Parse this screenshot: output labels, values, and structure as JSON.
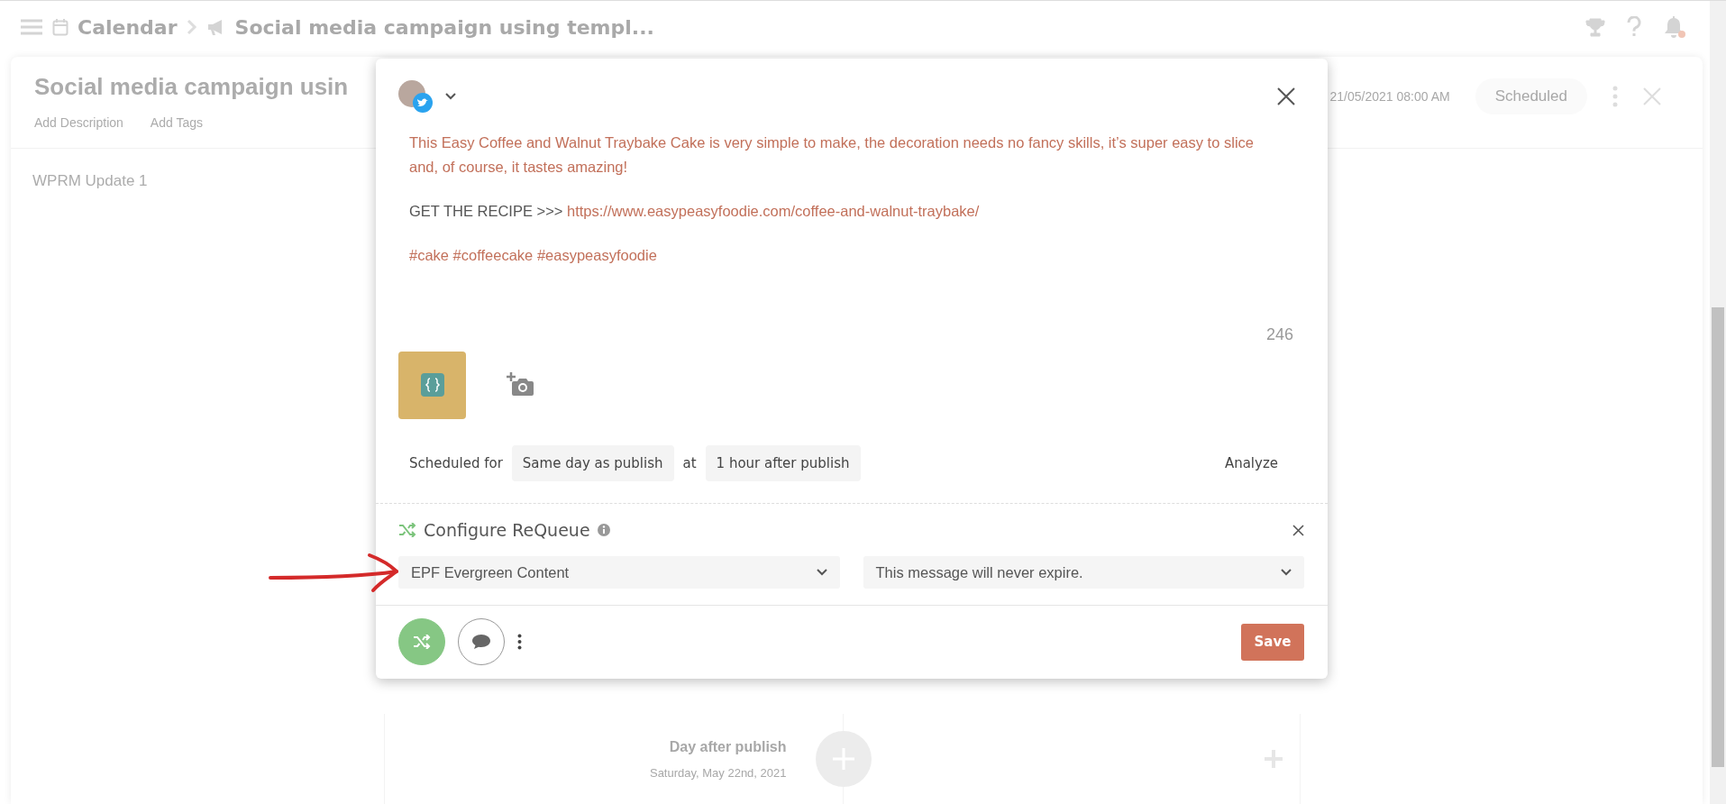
{
  "top_bar": {
    "breadcrumbs": [
      {
        "kind": "calendar",
        "label": "Calendar"
      },
      {
        "kind": "campaign",
        "label": "Social media campaign using templ..."
      }
    ],
    "has_notification": true
  },
  "campaign": {
    "title": "Social media campaign usin",
    "links": [
      "Add Description",
      "Add Tags"
    ],
    "date": "21/05/2021 08:00 AM",
    "status": "Scheduled",
    "items": [
      "WPRM Update 1"
    ]
  },
  "timeline": {
    "label": "Day after publish",
    "date": "Saturday, May 22nd, 2021"
  },
  "dialog": {
    "message": [
      [
        {
          "kind": "highlight",
          "text": "This Easy Coffee and Walnut Traybake Cake is very simple to make, the decoration needs no fancy skills, it’s super easy to slice and, of course, it tastes amazing!"
        }
      ],
      [
        {
          "kind": "plain",
          "text": "GET THE RECIPE >>> "
        },
        {
          "kind": "highlight",
          "text": "https://www.easypeasyfoodie.com/coffee-and-walnut-traybake/"
        }
      ],
      [
        {
          "kind": "highlight",
          "text": "#cake #coffeecake #easypeasyfoodie"
        }
      ]
    ],
    "char_count": "246",
    "schedule": {
      "label": "Scheduled for",
      "day": "Same day as publish",
      "connector": "at",
      "time": "1 hour after publish"
    },
    "analyze": "Analyze",
    "requeue": {
      "title": "Configure ReQueue",
      "pool": "EPF Evergreen Content",
      "expiry": "This message will never expire."
    },
    "requeue_enabled": true,
    "save": "Save"
  }
}
